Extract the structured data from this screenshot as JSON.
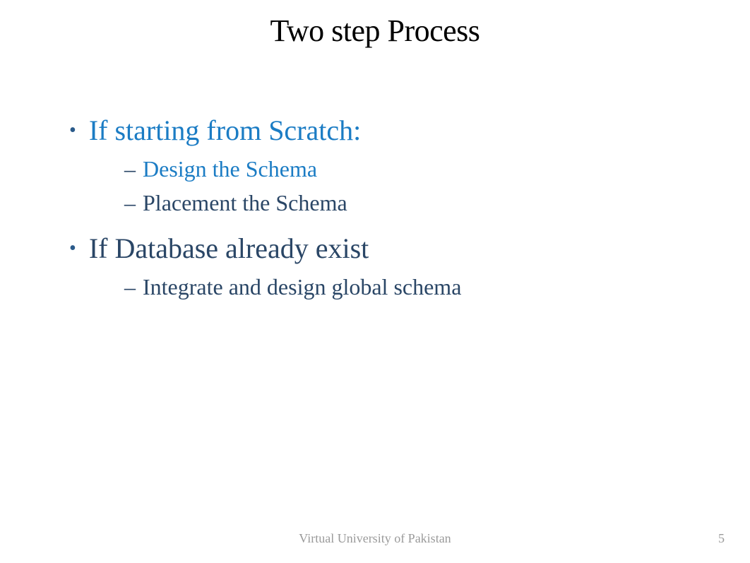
{
  "title": "Two step Process",
  "bullet1": {
    "text": "If starting from Scratch:",
    "subs": {
      "s1": "Design the Schema",
      "s2": "Placement the Schema"
    }
  },
  "bullet2": {
    "text": "If Database already exist",
    "subs": {
      "s1": "Integrate and design global schema"
    }
  },
  "footer": {
    "org": "Virtual University of Pakistan",
    "page": "5"
  }
}
